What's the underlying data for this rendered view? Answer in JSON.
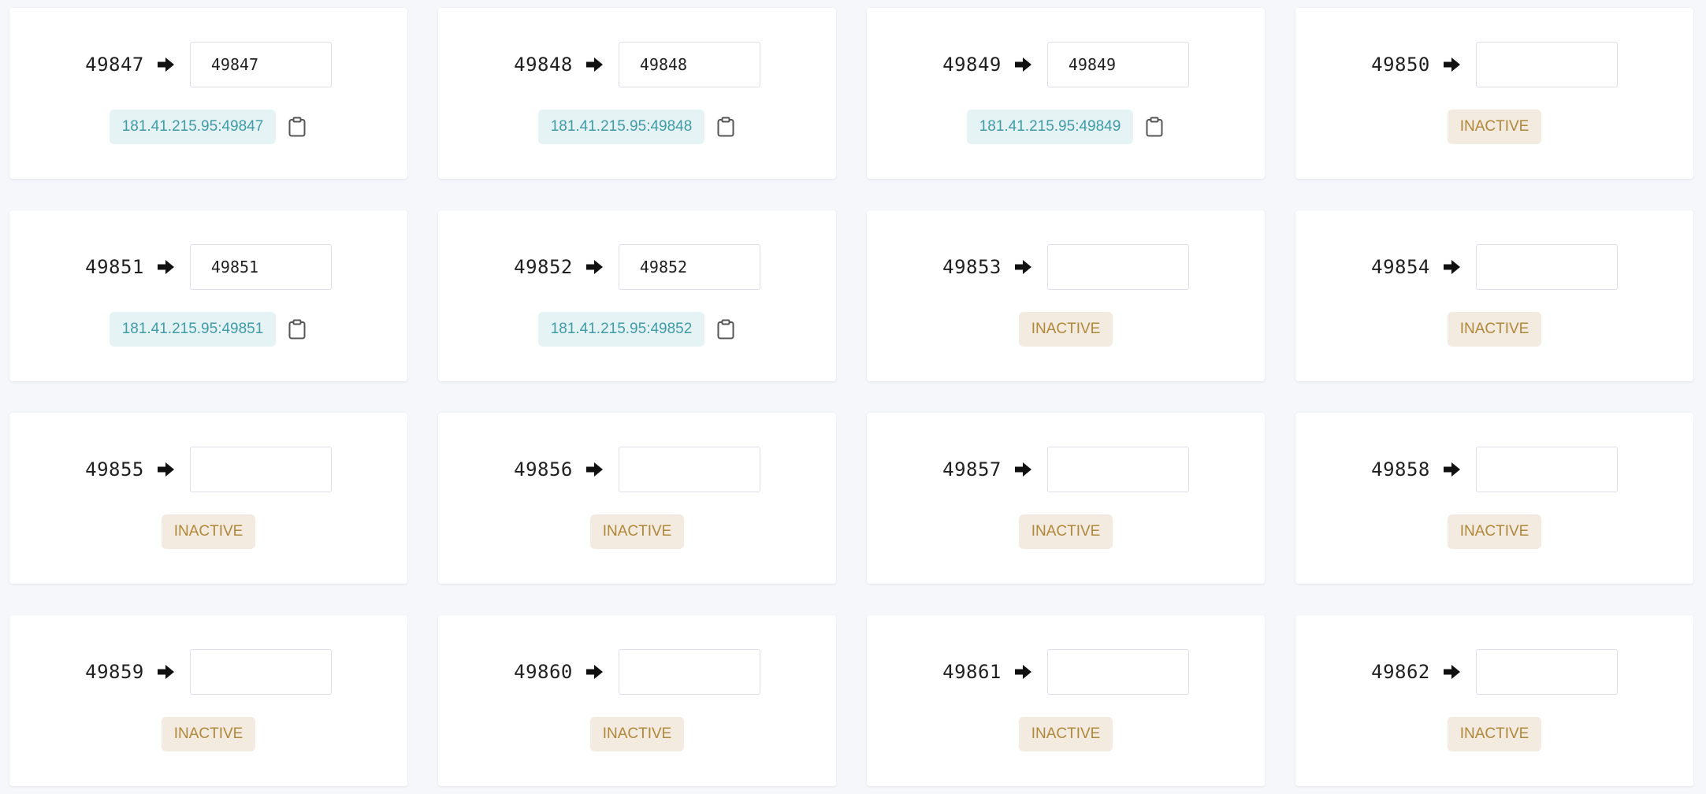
{
  "inactive_label": "INACTIVE",
  "icons": {
    "arrow": "arrow-right-icon",
    "copy": "clipboard-icon"
  },
  "colors": {
    "active_tag_bg": "#e6f3f4",
    "active_tag_text": "#3f9ba7",
    "inactive_tag_bg": "#f3ebdf",
    "inactive_tag_text": "#b1873a"
  },
  "ports": [
    {
      "port": "49847",
      "value": "49847",
      "active": true,
      "address": "181.41.215.95:49847"
    },
    {
      "port": "49848",
      "value": "49848",
      "active": true,
      "address": "181.41.215.95:49848"
    },
    {
      "port": "49849",
      "value": "49849",
      "active": true,
      "address": "181.41.215.95:49849"
    },
    {
      "port": "49850",
      "value": "",
      "active": false,
      "address": ""
    },
    {
      "port": "49851",
      "value": "49851",
      "active": true,
      "address": "181.41.215.95:49851"
    },
    {
      "port": "49852",
      "value": "49852",
      "active": true,
      "address": "181.41.215.95:49852"
    },
    {
      "port": "49853",
      "value": "",
      "active": false,
      "address": ""
    },
    {
      "port": "49854",
      "value": "",
      "active": false,
      "address": ""
    },
    {
      "port": "49855",
      "value": "",
      "active": false,
      "address": ""
    },
    {
      "port": "49856",
      "value": "",
      "active": false,
      "address": ""
    },
    {
      "port": "49857",
      "value": "",
      "active": false,
      "address": ""
    },
    {
      "port": "49858",
      "value": "",
      "active": false,
      "address": ""
    },
    {
      "port": "49859",
      "value": "",
      "active": false,
      "address": ""
    },
    {
      "port": "49860",
      "value": "",
      "active": false,
      "address": ""
    },
    {
      "port": "49861",
      "value": "",
      "active": false,
      "address": ""
    },
    {
      "port": "49862",
      "value": "",
      "active": false,
      "address": ""
    }
  ]
}
